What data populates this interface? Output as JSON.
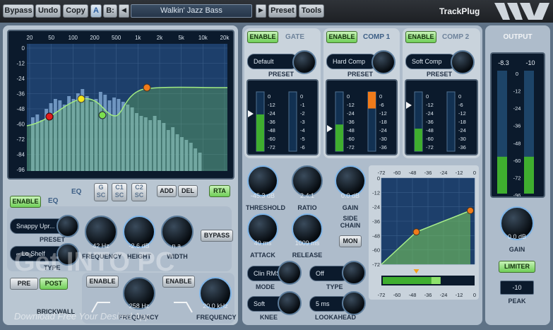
{
  "toolbar": {
    "bypass": "Bypass",
    "undo": "Undo",
    "copy": "Copy",
    "ab_a": "A",
    "ab_b": "B:",
    "prev": "◀",
    "next": "▶",
    "preset_name": "Walkin' Jazz Bass",
    "preset": "Preset",
    "tools": "Tools",
    "brand": "TrackPlug"
  },
  "eq": {
    "freq_ticks": [
      "20",
      "50",
      "100",
      "200",
      "500",
      "1k",
      "2k",
      "5k",
      "10k",
      "20k"
    ],
    "db_ticks": [
      "-12",
      "-24",
      "-36",
      "-48",
      "-60",
      "-72",
      "-84",
      "-96"
    ],
    "top_tick": "0",
    "tabs": {
      "eq": "EQ",
      "g": "G",
      "g_sc": "SC",
      "c1": "C1",
      "c1_sc": "SC",
      "c2": "C2",
      "c2_sc": "SC"
    },
    "add": "ADD",
    "del": "DEL",
    "rta": "RTA",
    "enable": "ENABLE",
    "section": "EQ",
    "preset_value": "Snappy Upr...",
    "preset_label": "PRESET",
    "type_value": "Lo Shelf",
    "type_label": "TYPE",
    "pre": "PRE",
    "post": "POST",
    "freq_val": "42 Hz",
    "freq_label": "FREQUENCY",
    "height_val": "-2.6 dB",
    "height_label": "HEIGHT",
    "width_val": "n.a.",
    "width_label": "WIDTH",
    "bypass": "BYPASS"
  },
  "brickwall": {
    "label": "BRICKWALL",
    "enable_lo": "ENABLE",
    "enable_hi": "ENABLE",
    "lo_val": "258 Hz",
    "hi_val": "20.0 kHz",
    "freq_label": "FREQUENCY",
    "freq_label2": "FREQUENCY"
  },
  "gate": {
    "enable": "ENABLE",
    "title": "GATE",
    "preset": "Default",
    "preset_label": "PRESET"
  },
  "comp1": {
    "enable": "ENABLE",
    "title": "COMP 1",
    "preset": "Hard Comp",
    "preset_label": "PRESET"
  },
  "comp2": {
    "enable": "ENABLE",
    "title": "COMP 2",
    "preset": "Soft Comp",
    "preset_label": "PRESET"
  },
  "meter_scale_a": [
    "0",
    "-12",
    "-24",
    "-36",
    "-48",
    "-60",
    "-72"
  ],
  "meter_scale_b": [
    "0",
    "-1",
    "-2",
    "-3",
    "-4",
    "-5",
    "-6"
  ],
  "meter_scale_c": [
    "0",
    "-6",
    "-12",
    "-18",
    "-24",
    "-30",
    "-36"
  ],
  "dynamics": {
    "threshold_val": "-45.3 dB",
    "threshold_label": "THRESHOLD",
    "ratio_val": "2.4:1",
    "ratio_label": "RATIO",
    "gain_val": "0.0 dB",
    "gain_label": "GAIN",
    "attack_val": "40 ms",
    "attack_label": "ATTACK",
    "release_val": "1009 ms",
    "release_label": "RELEASE",
    "sidechain": "SIDE CHAIN",
    "mon": "MON",
    "mode_val": "Clin RMS",
    "mode_label": "MODE",
    "type_val": "Off",
    "type_label": "TYPE",
    "knee_val": "Soft",
    "knee_label": "KNEE",
    "lookahead_val": "5 ms",
    "lookahead_label": "LOOKAHEAD"
  },
  "transfer": {
    "x_ticks": [
      "-72",
      "-60",
      "-48",
      "-36",
      "-24",
      "-12",
      "0"
    ],
    "y_ticks": [
      "0",
      "-12",
      "-24",
      "-36",
      "-48",
      "-60",
      "-72"
    ]
  },
  "output": {
    "title": "OUTPUT",
    "left_val": "-8.3",
    "right_val": "-10",
    "scale": [
      "0",
      "-12",
      "-24",
      "-36",
      "-48",
      "-60",
      "-72",
      "-96"
    ],
    "gain_val": "0.0 dB",
    "gain_label": "GAIN",
    "limiter": "LIMITER",
    "peak_val": "-10",
    "peak_label": "PEAK"
  },
  "watermark": {
    "title": "Get INTO PC",
    "sub": "Download Free Your Desired App"
  },
  "colors": {
    "accent_green": "#7ad86a",
    "meter_green": "#3fae2f",
    "node_orange": "#f07b1a",
    "node_red": "#e01c1c",
    "node_yellow": "#f3e61a",
    "node_green": "#7be04e"
  }
}
